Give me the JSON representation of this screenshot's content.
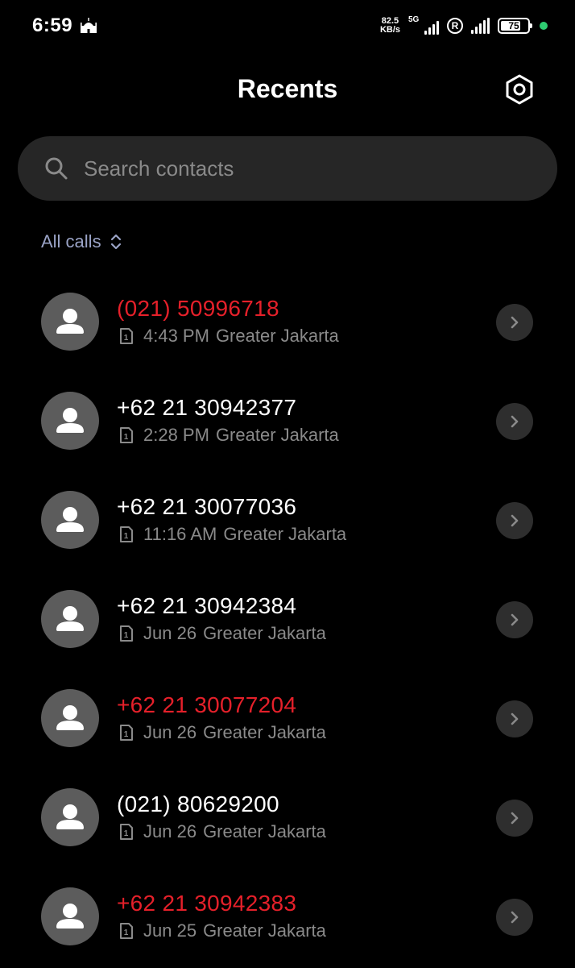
{
  "status_bar": {
    "time": "6:59",
    "net_speed_value": "82.5",
    "net_speed_unit": "KB/s",
    "network_type": "5G",
    "roaming_label": "R",
    "battery_level": "75",
    "battery_fraction": 0.75,
    "charge_dot_color": "#2ecc71"
  },
  "header": {
    "title": "Recents"
  },
  "search": {
    "placeholder": "Search contacts"
  },
  "filter": {
    "label": "All calls"
  },
  "colors": {
    "missed": "#e5202a",
    "normal": "#ffffff",
    "secondary": "#8a8a8a",
    "accent_filter": "#9aa3c6"
  },
  "calls": [
    {
      "number": "(021) 50996718",
      "missed": true,
      "sim": "1",
      "time": "4:43 PM",
      "location": "Greater Jakarta"
    },
    {
      "number": "+62 21 30942377",
      "missed": false,
      "sim": "1",
      "time": "2:28 PM",
      "location": "Greater Jakarta"
    },
    {
      "number": "+62 21 30077036",
      "missed": false,
      "sim": "1",
      "time": "11:16 AM",
      "location": "Greater Jakarta"
    },
    {
      "number": "+62 21 30942384",
      "missed": false,
      "sim": "1",
      "time": "Jun 26",
      "location": "Greater Jakarta"
    },
    {
      "number": "+62 21 30077204",
      "missed": true,
      "sim": "1",
      "time": "Jun 26",
      "location": "Greater Jakarta"
    },
    {
      "number": "(021) 80629200",
      "missed": false,
      "sim": "1",
      "time": "Jun 26",
      "location": "Greater Jakarta"
    },
    {
      "number": "+62 21 30942383",
      "missed": true,
      "sim": "1",
      "time": "Jun 25",
      "location": "Greater Jakarta"
    }
  ]
}
